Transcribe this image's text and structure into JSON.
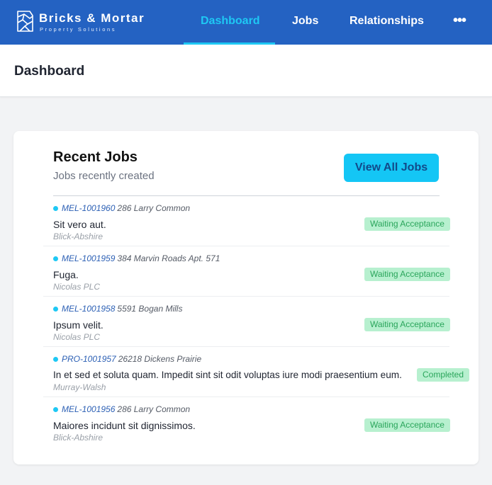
{
  "brand": {
    "name": "Bricks & Mortar",
    "tagline": "Property Solutions",
    "accent": "#1ec8f4",
    "primary": "#2462c2",
    "icon": "building-logo-icon"
  },
  "nav": {
    "items": [
      "Dashboard",
      "Jobs",
      "Relationships"
    ],
    "active": "Dashboard",
    "more_icon": "more-dots-icon"
  },
  "page": {
    "title": "Dashboard"
  },
  "recent_jobs": {
    "title": "Recent Jobs",
    "subtitle": "Jobs recently created",
    "view_all_label": "View All Jobs",
    "jobs": [
      {
        "ref": "MEL-1001960",
        "address": "286 Larry Common",
        "title": "Sit vero aut.",
        "client": "Blick-Abshire",
        "status": "Waiting Acceptance"
      },
      {
        "ref": "MEL-1001959",
        "address": "384 Marvin Roads Apt. 571",
        "title": "Fuga.",
        "client": "Nicolas PLC",
        "status": "Waiting Acceptance"
      },
      {
        "ref": "MEL-1001958",
        "address": "5591 Bogan Mills",
        "title": "Ipsum velit.",
        "client": "Nicolas PLC",
        "status": "Waiting Acceptance"
      },
      {
        "ref": "PRO-1001957",
        "address": "26218 Dickens Prairie",
        "title": "In et sed et soluta quam. Impedit sint sit odit voluptas iure modi praesentium eum.",
        "client": "Murray-Walsh",
        "status": "Completed"
      },
      {
        "ref": "MEL-1001956",
        "address": "286 Larry Common",
        "title": "Maiores incidunt sit dignissimos.",
        "client": "Blick-Abshire",
        "status": "Waiting Acceptance"
      }
    ]
  }
}
